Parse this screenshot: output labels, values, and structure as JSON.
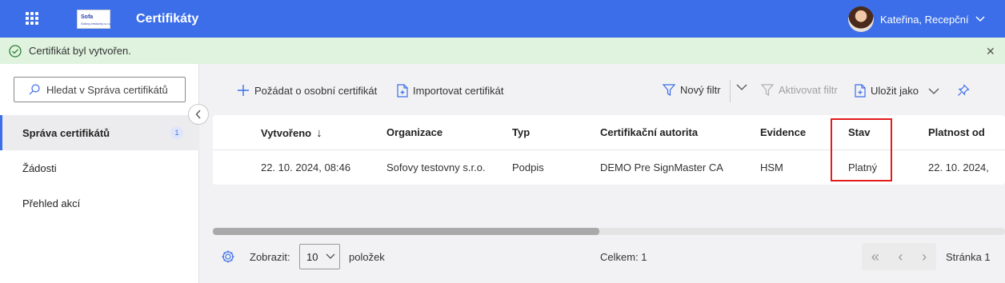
{
  "header": {
    "apps_icon": "app-launcher-grid-icon",
    "logo_text": "Sofa",
    "logo_subtext": "Sofovy testovny s.r.o.",
    "title": "Certifikáty",
    "user_name": "Kateřina, Recepční",
    "user_menu_icon": "chevron-down-icon",
    "brand_color": "#3b6ee8"
  },
  "banner": {
    "message": "Certifikát byl vytvořen.",
    "icon": "success-check-icon",
    "close_icon": "close-icon",
    "color": "#dff3df"
  },
  "sidebar": {
    "search_placeholder": "Hledat v Správa certifikátů",
    "items": [
      {
        "label": "Správa certifikátů",
        "badge": "1",
        "active": true
      },
      {
        "label": "Žádosti",
        "active": false
      },
      {
        "label": "Přehled akcí",
        "active": false
      }
    ]
  },
  "toolbar": {
    "request_personal": "Požádat o osobní certifikát",
    "import": "Importovat certifikát",
    "new_filter": "Nový filtr",
    "activate_filter": "Aktivovat filtr",
    "save_as": "Uložit jako"
  },
  "table": {
    "columns": [
      "Vytvořeno",
      "Organizace",
      "Typ",
      "Certifikační autorita",
      "Evidence",
      "Stav",
      "Platnost od"
    ],
    "sorted_column": "Vytvořeno",
    "sort_direction": "descending",
    "rows": [
      [
        "22. 10. 2024, 08:46",
        "Sofovy testovny s.r.o.",
        "Podpis",
        "DEMO Pre SignMaster CA",
        "HSM",
        "Platný",
        "22. 10. 2024,"
      ]
    ],
    "highlight_color": "#e21b1b"
  },
  "footer": {
    "show_label": "Zobrazit:",
    "page_size": "10",
    "items_label": "položek",
    "total": "Celkem: 1",
    "page": "Stránka 1"
  }
}
